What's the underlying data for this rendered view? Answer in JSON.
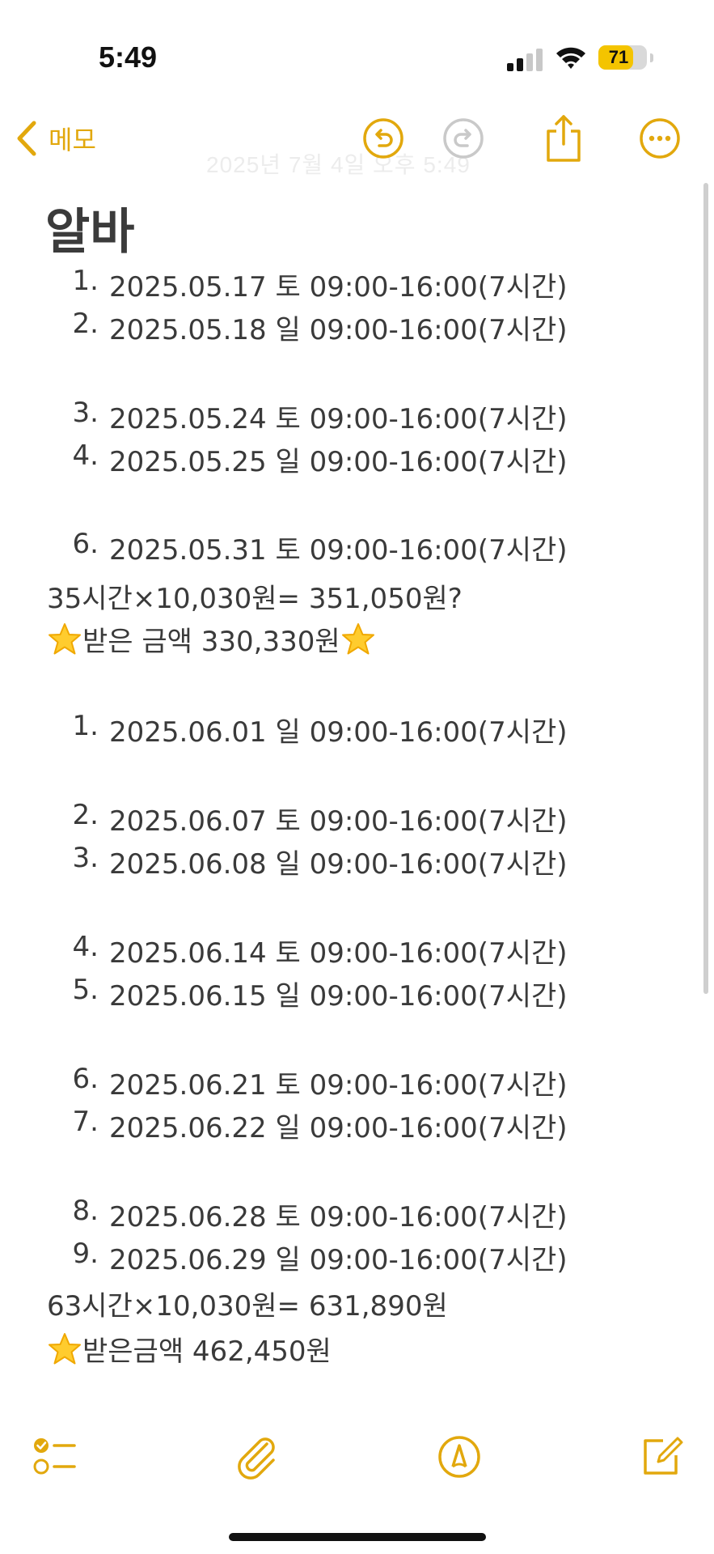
{
  "status_bar": {
    "time": "5:49",
    "battery_level": 71,
    "battery_text": "71"
  },
  "nav": {
    "back_label": "메모",
    "faded_date": "2025년 7월 4일 오후 5:49",
    "icons": [
      "chevron-left-icon",
      "undo-icon",
      "redo-icon",
      "share-icon",
      "more-icon"
    ]
  },
  "note": {
    "title": "알바",
    "may_entries": [
      {
        "num": "1.",
        "text": "2025.05.17 토 09:00-16:00(7시간)"
      },
      {
        "num": "2.",
        "text": "2025.05.18 일 09:00-16:00(7시간)"
      },
      {
        "num": "3.",
        "text": "2025.05.24 토 09:00-16:00(7시간)"
      },
      {
        "num": "4.",
        "text": "2025.05.25 일 09:00-16:00(7시간)"
      },
      {
        "num": "6.",
        "text": "2025.05.31 토 09:00-16:00(7시간)"
      }
    ],
    "may_calc": "35시간×10,030원= 351,050원?",
    "may_received": "받은 금액 330,330원",
    "june_entries": [
      {
        "num": "1.",
        "text": "2025.06.01 일 09:00-16:00(7시간)"
      },
      {
        "num": "2.",
        "text": "2025.06.07 토 09:00-16:00(7시간)"
      },
      {
        "num": "3.",
        "text": "2025.06.08 일 09:00-16:00(7시간)"
      },
      {
        "num": "4.",
        "text": "2025.06.14 토 09:00-16:00(7시간)"
      },
      {
        "num": "5.",
        "text": "2025.06.15 일 09:00-16:00(7시간)"
      },
      {
        "num": "6.",
        "text": "2025.06.21 토 09:00-16:00(7시간)"
      },
      {
        "num": "7.",
        "text": "2025.06.22 일 09:00-16:00(7시간)"
      },
      {
        "num": "8.",
        "text": "2025.06.28 토 09:00-16:00(7시간)"
      },
      {
        "num": "9.",
        "text": "2025.06.29 일 09:00-16:00(7시간)"
      }
    ],
    "june_calc": "63시간×10,030원= 631,890원",
    "june_received": "받은금액 462,450원"
  },
  "toolbar": {
    "icons": [
      "checklist-icon",
      "attachment-icon",
      "markup-icon",
      "compose-icon"
    ]
  },
  "colors": {
    "accent": "#e2a80d",
    "text": "#3a3a3a",
    "battery": "#f4c400"
  }
}
